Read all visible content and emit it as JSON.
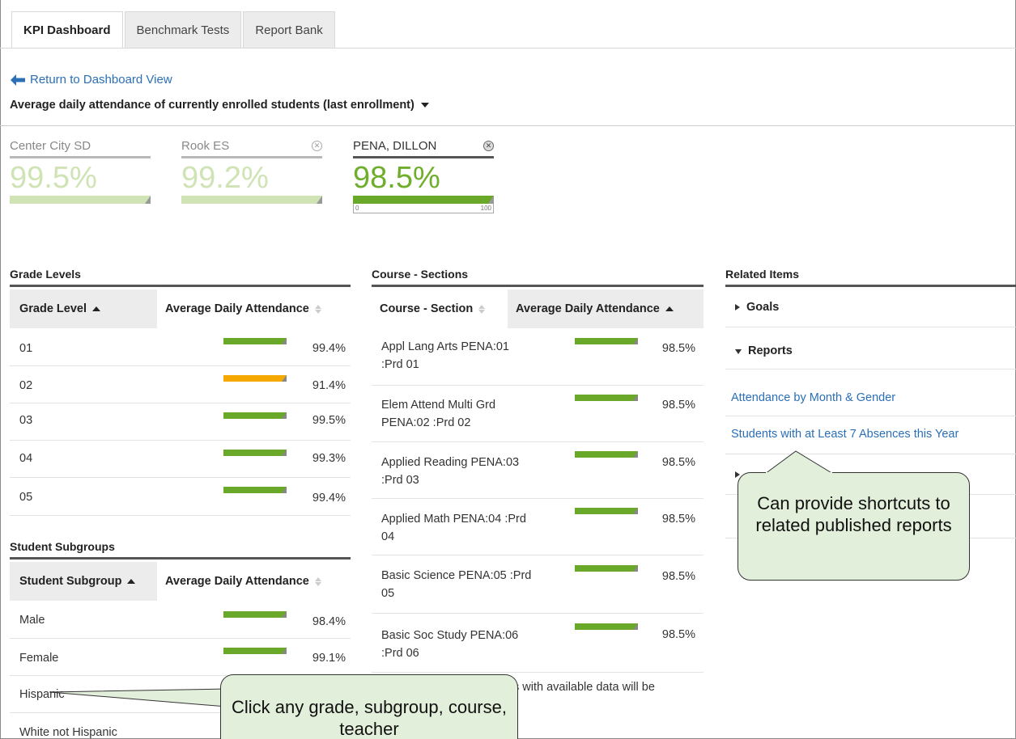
{
  "tabs": [
    "KPI Dashboard",
    "Benchmark Tests",
    "Report Bank"
  ],
  "back_link": "Return to Dashboard View",
  "measure": "Average daily attendance of currently enrolled students (last enrollment)",
  "kpis": [
    {
      "name": "Center City SD",
      "value": "99.5%",
      "level": 99.5
    },
    {
      "name": "Rook ES",
      "value": "99.2%",
      "level": 99.2
    },
    {
      "name": "PENA, DILLON",
      "value": "98.5%",
      "level": 98.5,
      "scale_min": "0",
      "scale_max": "100"
    }
  ],
  "grade_levels": {
    "title": "Grade Levels",
    "col1": "Grade Level",
    "col2": "Average Daily Attendance",
    "rows": [
      {
        "label": "01",
        "pct": "99.4%"
      },
      {
        "label": "02",
        "pct": "91.4%"
      },
      {
        "label": "03",
        "pct": "99.5%"
      },
      {
        "label": "04",
        "pct": "99.3%"
      },
      {
        "label": "05",
        "pct": "99.4%"
      }
    ]
  },
  "subgroups": {
    "title": "Student Subgroups",
    "col1": "Student Subgroup",
    "col2": "Average Daily Attendance",
    "rows": [
      {
        "label": "Male",
        "pct": "98.4%"
      },
      {
        "label": "Female",
        "pct": "99.1%"
      },
      {
        "label": "Hispanic",
        "pct": ""
      },
      {
        "label": "White not Hispanic",
        "pct": ""
      }
    ]
  },
  "courses": {
    "title": "Course - Sections",
    "col1": "Course - Section",
    "col2": "Average Daily Attendance",
    "rows": [
      {
        "line1": "Appl Lang Arts PENA:01",
        "line2": ":Prd 01",
        "pct": "98.5%"
      },
      {
        "line1": "Elem Attend Multi Grd",
        "line2": "PENA:02 :Prd 02",
        "pct": "98.5%"
      },
      {
        "line1": "Applied Reading PENA:03",
        "line2": ":Prd 03",
        "pct": "98.5%"
      },
      {
        "line1": "Applied Math PENA:04 :Prd",
        "line2": "04",
        "pct": "98.5%"
      },
      {
        "line1": "Basic Science PENA:05 :Prd",
        "line2": "05",
        "pct": "98.5%"
      },
      {
        "line1": "Basic Soc Study PENA:06",
        "line2": ":Prd 06",
        "pct": "98.5%"
      }
    ],
    "note": "s with available data will be"
  },
  "related": {
    "title": "Related Items",
    "goals": "Goals",
    "reports": "Reports",
    "report_links": [
      "Attendance by Month & Gender",
      "Students with at Least 7 Absences this Year"
    ]
  },
  "callouts": {
    "reports": "Can provide shortcuts to related published reports",
    "click": "Click any grade, subgroup, course, teacher"
  },
  "colors": {
    "bar": "#6aa82a",
    "warn_bar": "#f5a800",
    "link": "#2a6fb7",
    "callout_bg": "#e2efda"
  }
}
